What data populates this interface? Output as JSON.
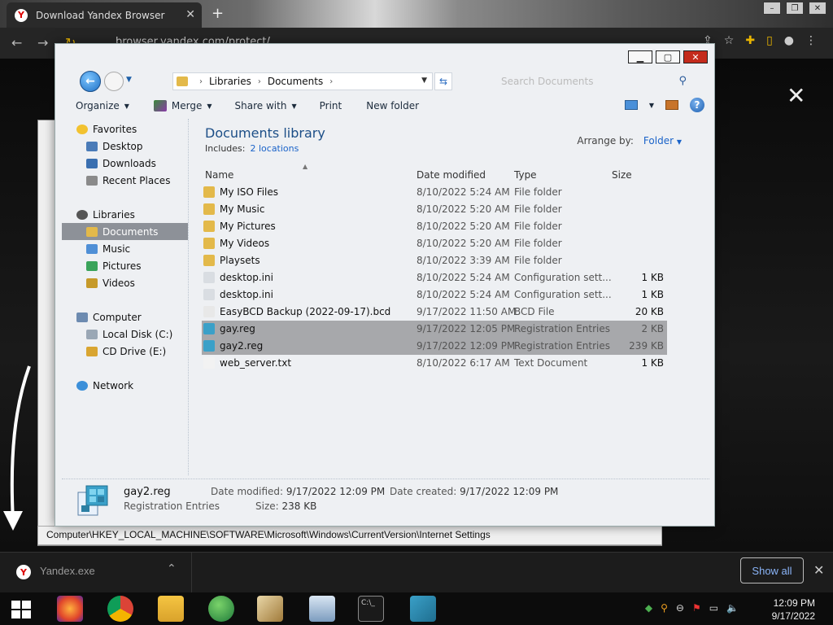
{
  "browser": {
    "tab_title": "Download Yandex Browser",
    "url": "browser.yandex.com/protect/"
  },
  "explorer": {
    "breadcrumb": [
      "Libraries",
      "Documents"
    ],
    "search_placeholder": "Search Documents",
    "toolbar": {
      "organize": "Organize",
      "merge": "Merge",
      "share_with": "Share with",
      "print": "Print",
      "new_folder": "New folder"
    },
    "nav": {
      "favorites": "Favorites",
      "desktop": "Desktop",
      "downloads": "Downloads",
      "recent_places": "Recent Places",
      "libraries": "Libraries",
      "documents": "Documents",
      "music": "Music",
      "pictures": "Pictures",
      "videos": "Videos",
      "computer": "Computer",
      "local_disk": "Local Disk (C:)",
      "cd_drive": "CD Drive (E:)",
      "network": "Network"
    },
    "library_title": "Documents library",
    "includes_label": "Includes:",
    "includes_link": "2 locations",
    "arrange_label": "Arrange by:",
    "arrange_value": "Folder",
    "columns": {
      "name": "Name",
      "date": "Date modified",
      "type": "Type",
      "size": "Size"
    },
    "files": [
      {
        "name": "My ISO Files",
        "date": "8/10/2022 5:24 AM",
        "type": "File folder",
        "size": ""
      },
      {
        "name": "My Music",
        "date": "8/10/2022 5:20 AM",
        "type": "File folder",
        "size": ""
      },
      {
        "name": "My Pictures",
        "date": "8/10/2022 5:20 AM",
        "type": "File folder",
        "size": ""
      },
      {
        "name": "My Videos",
        "date": "8/10/2022 5:20 AM",
        "type": "File folder",
        "size": ""
      },
      {
        "name": "Playsets",
        "date": "8/10/2022 3:39 AM",
        "type": "File folder",
        "size": ""
      },
      {
        "name": "desktop.ini",
        "date": "8/10/2022 5:24 AM",
        "type": "Configuration sett...",
        "size": "1 KB"
      },
      {
        "name": "desktop.ini",
        "date": "8/10/2022 5:24 AM",
        "type": "Configuration sett...",
        "size": "1 KB"
      },
      {
        "name": "EasyBCD Backup (2022-09-17).bcd",
        "date": "9/17/2022 11:50 AM",
        "type": "BCD File",
        "size": "20 KB"
      },
      {
        "name": "gay.reg",
        "date": "9/17/2022 12:05 PM",
        "type": "Registration Entries",
        "size": "2 KB"
      },
      {
        "name": "gay2.reg",
        "date": "9/17/2022 12:09 PM",
        "type": "Registration Entries",
        "size": "239 KB"
      },
      {
        "name": "web_server.txt",
        "date": "8/10/2022 6:17 AM",
        "type": "Text Document",
        "size": "1 KB"
      }
    ],
    "details": {
      "name": "gay2.reg",
      "type": "Registration Entries",
      "modified_label": "Date modified:",
      "modified_value": "9/17/2022 12:09 PM",
      "created_label": "Date created:",
      "created_value": "9/17/2022 12:09 PM",
      "size_label": "Size:",
      "size_value": "238 KB"
    }
  },
  "regedit_status": "Computer\\HKEY_LOCAL_MACHINE\\SOFTWARE\\Microsoft\\Windows\\CurrentVersion\\Internet Settings",
  "download_bar": {
    "filename": "Yandex.exe",
    "show_all": "Show all"
  },
  "taskbar": {
    "time": "12:09 PM",
    "date": "9/17/2022"
  }
}
